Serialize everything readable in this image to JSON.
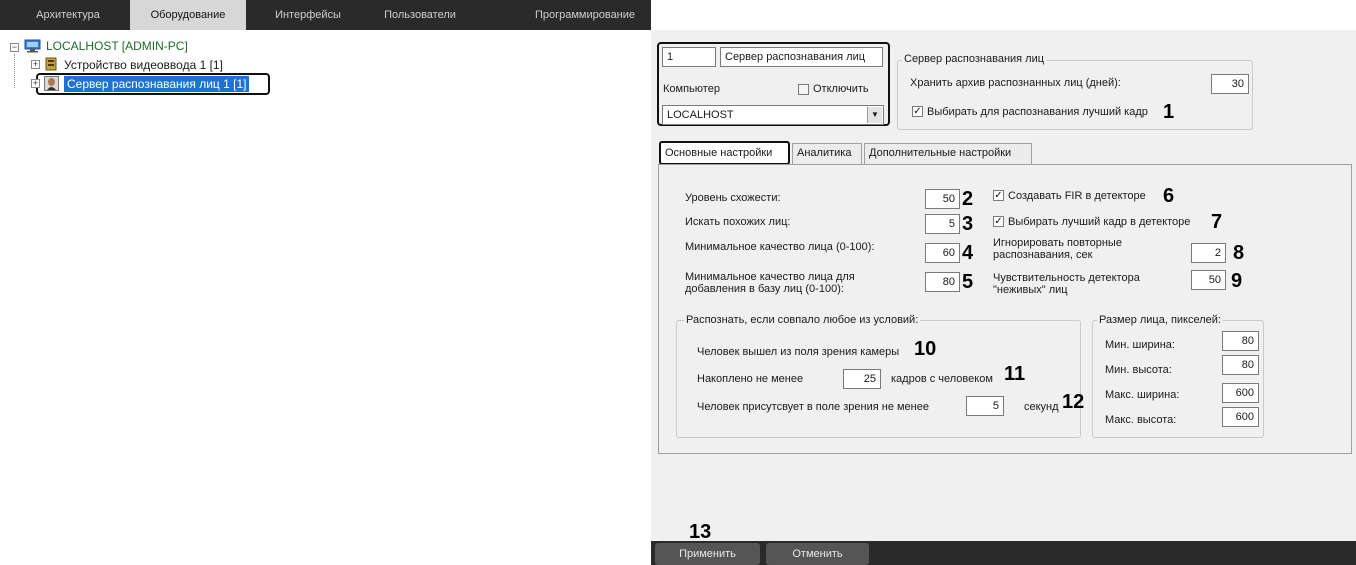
{
  "topbar": {
    "tabs": [
      {
        "label": "Архитектура"
      },
      {
        "label": "Оборудование"
      },
      {
        "label": "Интерфейсы"
      },
      {
        "label": "Пользователи"
      },
      {
        "label": "Программирование"
      }
    ],
    "active": "Оборудование"
  },
  "tree": {
    "root": "LOCALHOST [ADMIN-PC]",
    "items": [
      {
        "label": "Устройство видеоввода 1 [1]"
      },
      {
        "label": "Сервер распознавания лиц 1 [1]"
      }
    ]
  },
  "header": {
    "id_value": "1",
    "name_value": "Сервер распознавания лиц",
    "computer_label": "Компьютер",
    "disable_label": "Отключить",
    "computer_value": "LOCALHOST",
    "group_title": "Сервер распознавания лиц",
    "archive_label": "Хранить архив распознанных лиц (дней):",
    "archive_value": "30",
    "best_frame_label": "Выбирать для распознавания лучший кадр",
    "badge1": "1"
  },
  "tabs": [
    {
      "label": "Основные настройки"
    },
    {
      "label": "Аналитика"
    },
    {
      "label": "Дополнительные настройки"
    }
  ],
  "main": {
    "similarity_label": "Уровень схожести:",
    "similarity_value": "50",
    "search_similar_label": "Искать похожих лиц:",
    "search_similar_value": "5",
    "min_quality_label": "Минимальное качество лица (0-100):",
    "min_quality_value": "60",
    "min_quality_db_label": "Минимальное качество лица для добавления в базу лиц (0-100):",
    "min_quality_db_value": "80",
    "create_fir_label": "Создавать FIR в детекторе",
    "best_frame_detector_label": "Выбирать лучший кадр в детекторе",
    "ignore_repeat_label": "Игнорировать повторные распознавания, сек",
    "ignore_repeat_value": "2",
    "liveness_label": "Чувствительность детектора \"неживых\" лиц",
    "liveness_value": "50",
    "badges": [
      "2",
      "3",
      "4",
      "5",
      "6",
      "7",
      "8",
      "9",
      "10",
      "11",
      "12",
      "13"
    ]
  },
  "conditions": {
    "title": "Распознать, если совпало любое из условий:",
    "left_view_label": "Человек вышел из поля зрения камеры",
    "frames_prefix": "Накоплено не менее",
    "frames_value": "25",
    "frames_suffix": "кадров с человеком",
    "present_prefix": "Человек присутсвует в поле зрения не менее",
    "present_value": "5",
    "present_suffix": "секунд"
  },
  "face_size": {
    "title": "Размер лица, пикселей:",
    "min_width_label": "Мин. ширина:",
    "min_width_value": "80",
    "min_height_label": "Мин. высота:",
    "min_height_value": "80",
    "max_width_label": "Макс. ширина:",
    "max_width_value": "600",
    "max_height_label": "Макс. высота:",
    "max_height_value": "600"
  },
  "buttons": {
    "apply": "Применить",
    "cancel": "Отменить"
  }
}
